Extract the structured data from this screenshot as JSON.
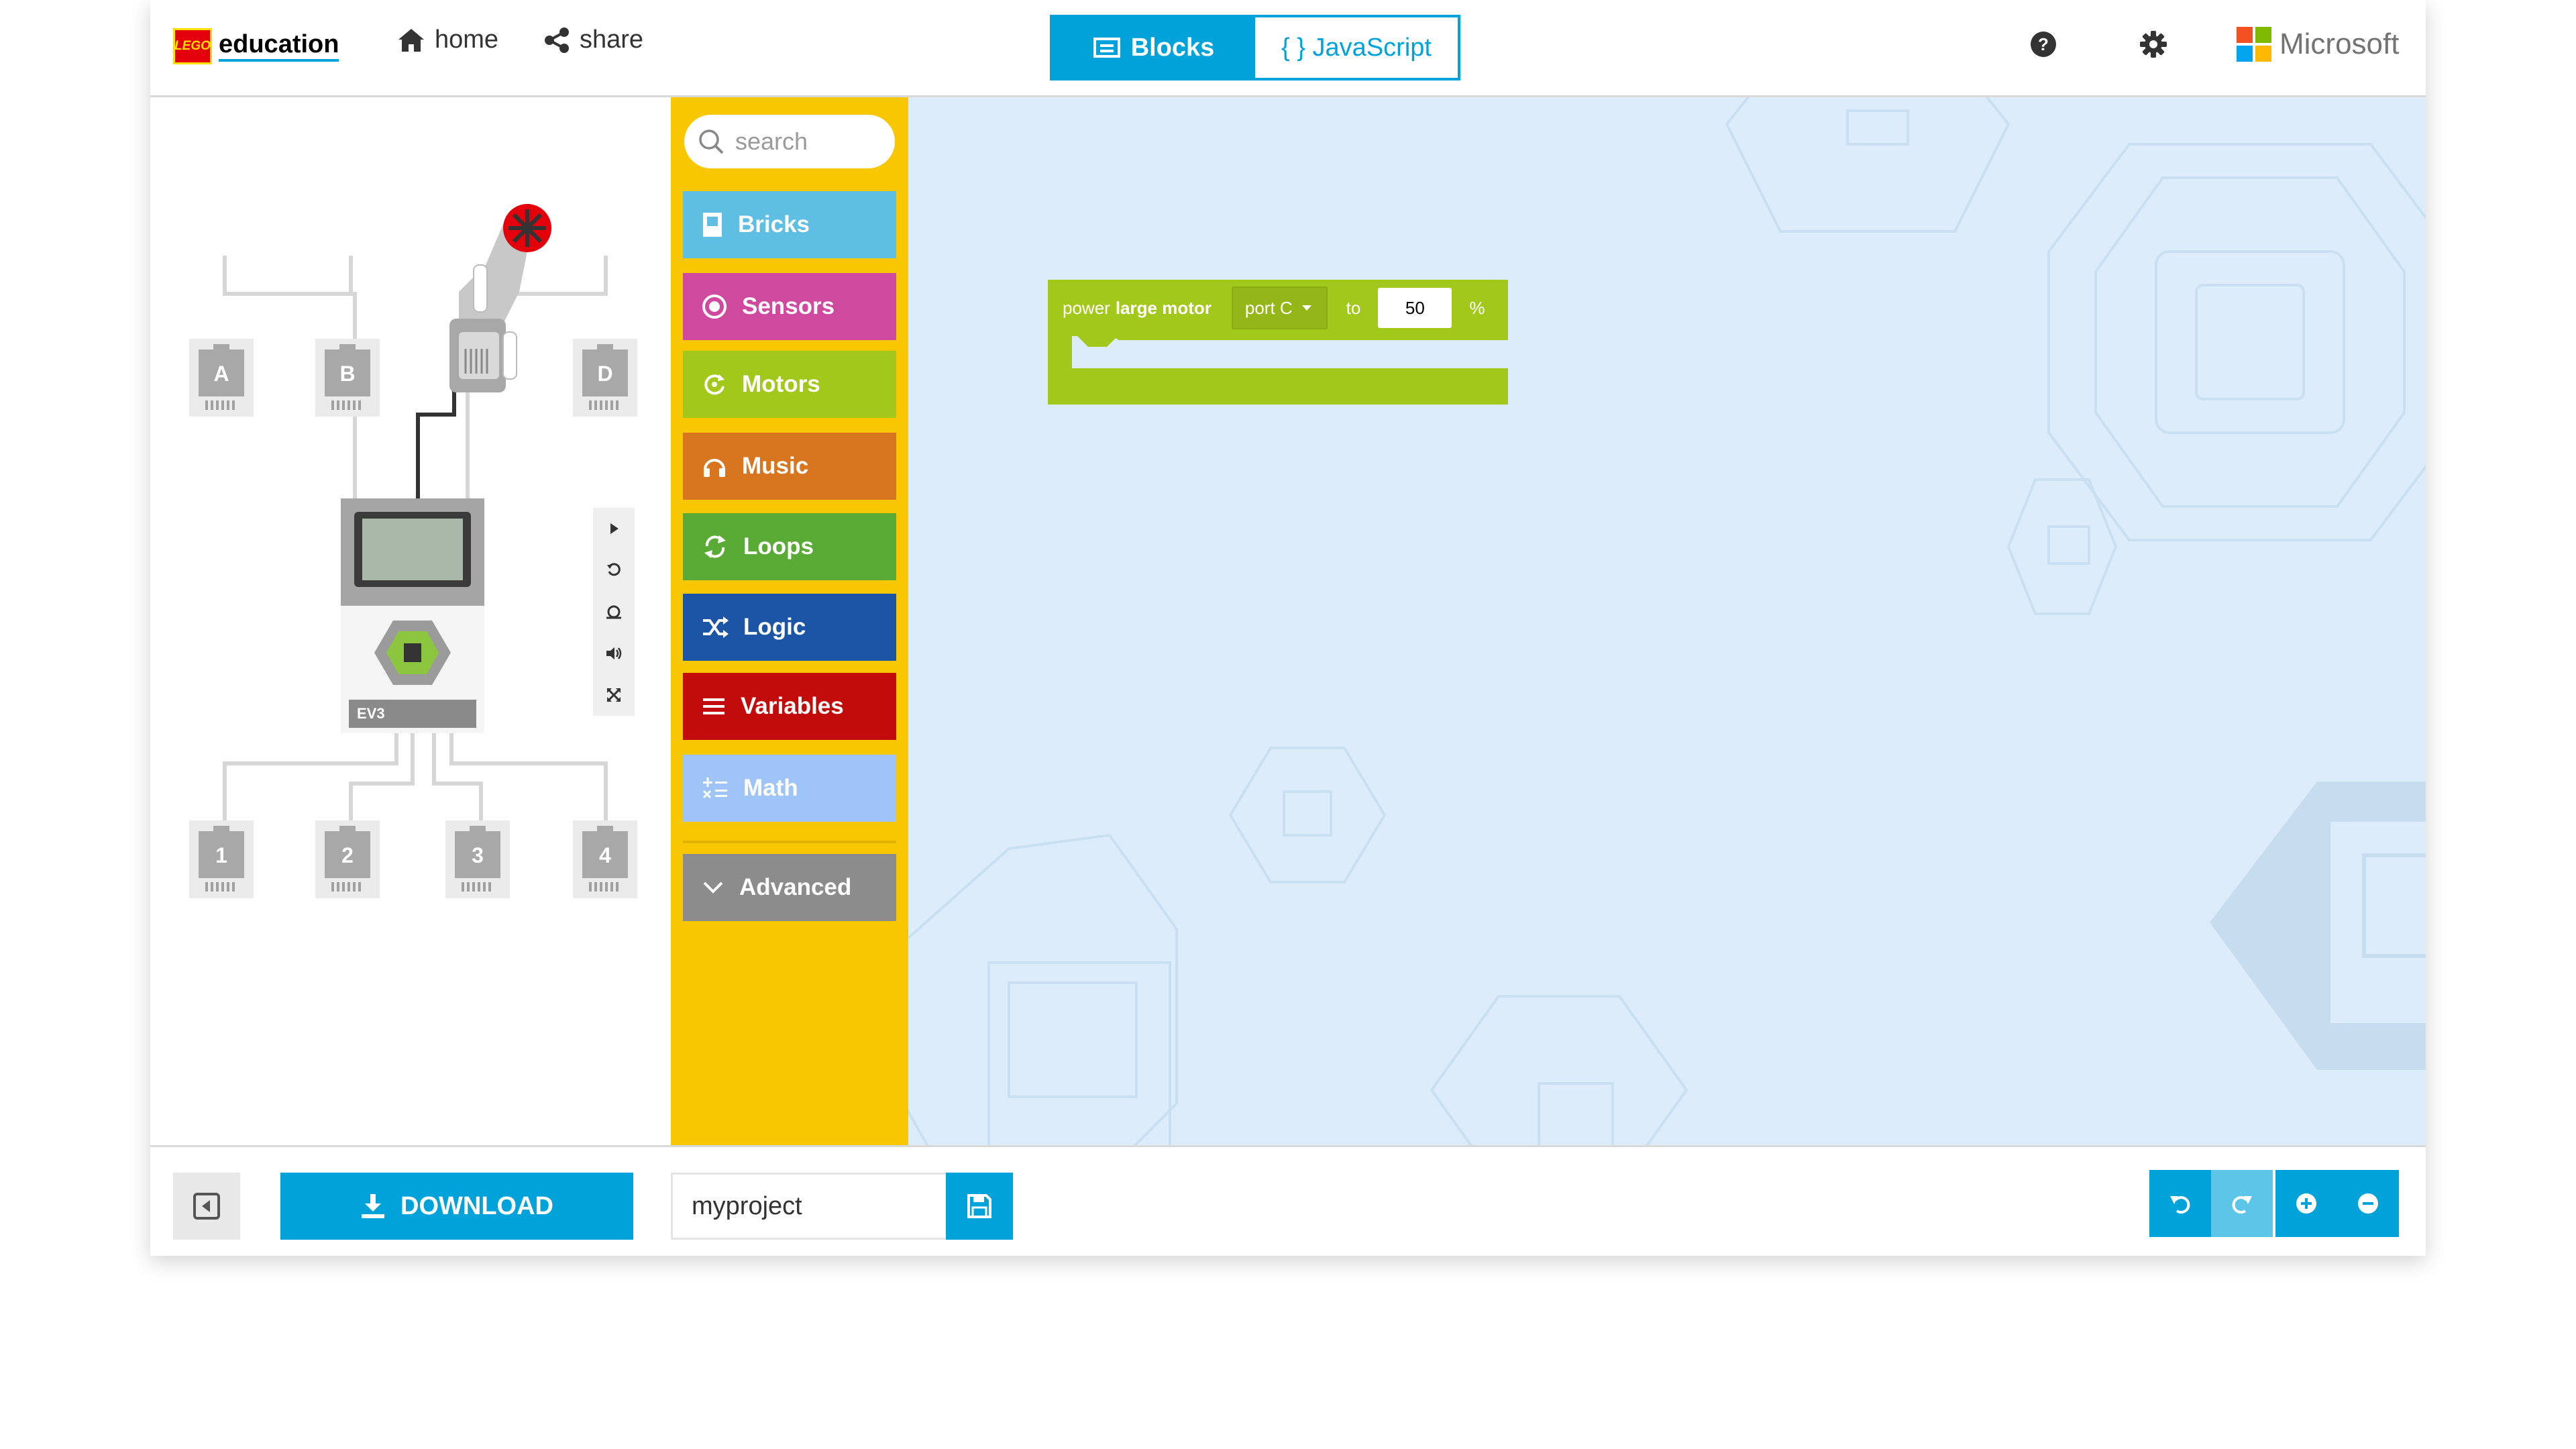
{
  "header": {
    "brand": "LEGO",
    "product": "education",
    "home_label": "home",
    "share_label": "share",
    "tab_blocks": "Blocks",
    "tab_javascript": "{ } JavaScript",
    "ms_label": "Microsoft"
  },
  "simulator": {
    "output_ports": [
      "A",
      "B",
      "D"
    ],
    "input_ports": [
      "1",
      "2",
      "3",
      "4"
    ],
    "brick_label": "EV3"
  },
  "toolbox": {
    "search_placeholder": "search",
    "categories": [
      {
        "label": "Bricks",
        "color": "#5ebfe3",
        "icon": "brick-icon"
      },
      {
        "label": "Sensors",
        "color": "#cf4a9e",
        "icon": "sensor-icon"
      },
      {
        "label": "Motors",
        "color": "#a3c81c",
        "icon": "motor-icon"
      },
      {
        "label": "Music",
        "color": "#d8751f",
        "icon": "headphones-icon"
      },
      {
        "label": "Loops",
        "color": "#5aab35",
        "icon": "loop-icon"
      },
      {
        "label": "Logic",
        "color": "#1d55a6",
        "icon": "shuffle-icon"
      },
      {
        "label": "Variables",
        "color": "#c20c0c",
        "icon": "list-icon"
      },
      {
        "label": "Math",
        "color": "#9fc5f8",
        "icon": "math-icon"
      }
    ],
    "advanced_label": "Advanced"
  },
  "workspace": {
    "block": {
      "prefix": "power",
      "bold": "large motor",
      "port": "port C",
      "to": "to",
      "value": "50",
      "unit": "%"
    }
  },
  "footer": {
    "download_label": "DOWNLOAD",
    "project_name": "myproject"
  },
  "colors": {
    "accent": "#00a3d9",
    "toolbox_bg": "#f9c700",
    "workspace_bg": "#dcecfb"
  }
}
